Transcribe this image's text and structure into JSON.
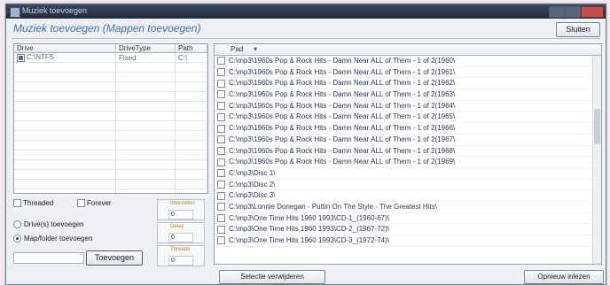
{
  "window": {
    "title": "Muziek toevoegen"
  },
  "header": {
    "title": "Muziek toevoegen (Mappen toevoegen)",
    "close_button": "Sluiten"
  },
  "drives": {
    "columns": [
      "Drive",
      "DriveType",
      "Path"
    ],
    "rows": [
      {
        "checked": true,
        "drive": "C:\\NTFS",
        "type": "Fixed",
        "path": "C:\\"
      }
    ]
  },
  "options": {
    "threaded": "Threaded",
    "forever": "Forever",
    "mode_drive": "Drive(s) toevoegen",
    "mode_map": "Map/folder toevoegen",
    "selected_mode": "map",
    "spin1_label": "Intervallen",
    "spin1_value": "0",
    "spin2_label": "Delay",
    "spin2_value": "0",
    "spin3_label": "Threads",
    "spin3_value": "0",
    "add_button": "Toevoegen"
  },
  "list": {
    "column_header": "Pad",
    "items": [
      "C:\\mp3\\1960s Pop & Rock Hits - Damn Near ALL of Them - 1 of 2(1960\\",
      "C:\\mp3\\1960s Pop & Rock Hits - Damn Near ALL of Them - 1 of 2(1961\\",
      "C:\\mp3\\1960s Pop & Rock Hits - Damn Near ALL of Them - 1 of 2(1962\\",
      "C:\\mp3\\1960s Pop & Rock Hits - Damn Near ALL of Them - 1 of 2(1963\\",
      "C:\\mp3\\1960s Pop & Rock Hits - Damn Near ALL of Them - 1 of 2(1964\\",
      "C:\\mp3\\1960s Pop & Rock Hits - Damn Near ALL of Them - 1 of 2(1965\\",
      "C:\\mp3\\1960s Pop & Rock Hits - Damn Near ALL of Them - 1 of 2(1966\\",
      "C:\\mp3\\1960s Pop & Rock Hits - Damn Near ALL of Them - 1 of 2(1967\\",
      "C:\\mp3\\1960s Pop & Rock Hits - Damn Near ALL of Them - 1 of 2(1968\\",
      "C:\\mp3\\1960s Pop & Rock Hits - Damn Near ALL of Them - 1 of 2(1969\\",
      "C:\\mp3\\Disc 1\\",
      "C:\\mp3\\Disc 2\\",
      "C:\\mp3\\Disc 3\\",
      "C:\\mp3\\Lonnie Donegan - Puttin On The Style - The Greatest Hits\\",
      "C:\\mp3\\One Time Hits 1960 1993\\CD-1_(1960-67)\\",
      "C:\\mp3\\One Time Hits 1960 1993\\CD-2_(1967-72)\\",
      "C:\\mp3\\One Time Hits 1960 1993\\CD-3_(1972-74)\\"
    ],
    "select_all_button": "Selectie verwijderen",
    "options_button": "Opnieuw inlezen"
  }
}
